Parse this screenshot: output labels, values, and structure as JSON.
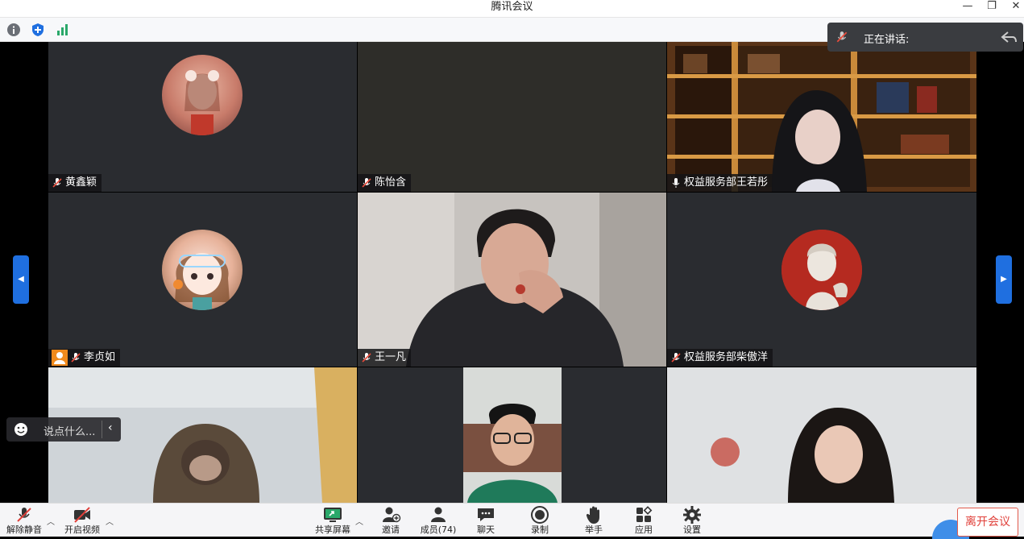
{
  "window": {
    "title": "腾讯会议"
  },
  "speaking": {
    "label": "正在讲话:"
  },
  "chat": {
    "placeholder": "说点什么..."
  },
  "participants": [
    {
      "name": "黄鑫颖",
      "mic": "muted",
      "display": "avatar"
    },
    {
      "name": "陈怡含",
      "mic": "muted",
      "display": "blank"
    },
    {
      "name": "权益服务部王若彤",
      "mic": "on",
      "display": "video"
    },
    {
      "name": "李贞如",
      "mic": "muted",
      "display": "avatar",
      "host_badge": true
    },
    {
      "name": "王一凡",
      "mic": "muted",
      "display": "video"
    },
    {
      "name": "权益服务部柴傲洋",
      "mic": "muted",
      "display": "avatar"
    },
    {
      "name": "",
      "display": "video"
    },
    {
      "name": "",
      "display": "video"
    },
    {
      "name": "",
      "display": "video"
    }
  ],
  "toolbar": {
    "unmute": "解除静音",
    "start_video": "开启视频",
    "share_screen": "共享屏幕",
    "invite": "邀请",
    "members": "成员(74)",
    "chat": "聊天",
    "record": "录制",
    "raise_hand": "举手",
    "apps": "应用",
    "settings": "设置",
    "leave": "离开会议"
  },
  "colors": {
    "accent": "#1f6fe0",
    "danger": "#e0403a",
    "share": "#2aa86a"
  }
}
